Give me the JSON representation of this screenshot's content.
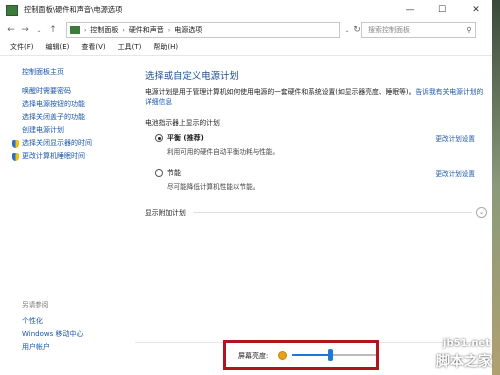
{
  "window": {
    "title": "控制面板\\硬件和声音\\电源选项",
    "controls": [
      "—",
      "☐",
      "✕"
    ]
  },
  "address": {
    "crumbs": [
      "控制面板",
      "硬件和声音",
      "电源选项"
    ],
    "search_placeholder": "搜索控制面板"
  },
  "menu": [
    "文件(F)",
    "编辑(E)",
    "查看(V)",
    "工具(T)",
    "帮助(H)"
  ],
  "sidebar": {
    "home": "控制面板主页",
    "items": [
      "唤醒时需要密码",
      "选择电源按钮的功能",
      "选择关闭盖子的功能",
      "创建电源计划",
      "选择关闭显示器的时间",
      "更改计算机睡眠时间"
    ],
    "also_label": "另请参阅",
    "also": [
      "个性化",
      "Windows 移动中心",
      "用户帐户"
    ]
  },
  "main": {
    "title": "选择或自定义电源计划",
    "desc_text": "电源计划是用于管理计算机如何使用电源的一套硬件和系统设置(如显示器亮度、睡眠等)。",
    "desc_link": "告诉我有关电源计划的详细信息",
    "group_label": "电池指示器上显示的计划",
    "plans": [
      {
        "name": "平衡 (推荐)",
        "desc": "利用可用的硬件自动平衡功耗与性能。",
        "selected": true,
        "change": "更改计划设置"
      },
      {
        "name": "节能",
        "desc": "尽可能降低计算机性能以节能。",
        "selected": false,
        "change": "更改计划设置"
      }
    ],
    "extra_label": "显示附加计划",
    "chevron": "⌄"
  },
  "brightness": {
    "label": "屏幕亮度:",
    "level": 0.45,
    "accent": "#1f78d1"
  },
  "watermark": {
    "line1": "jb51.net",
    "line2": "脚本之家"
  }
}
